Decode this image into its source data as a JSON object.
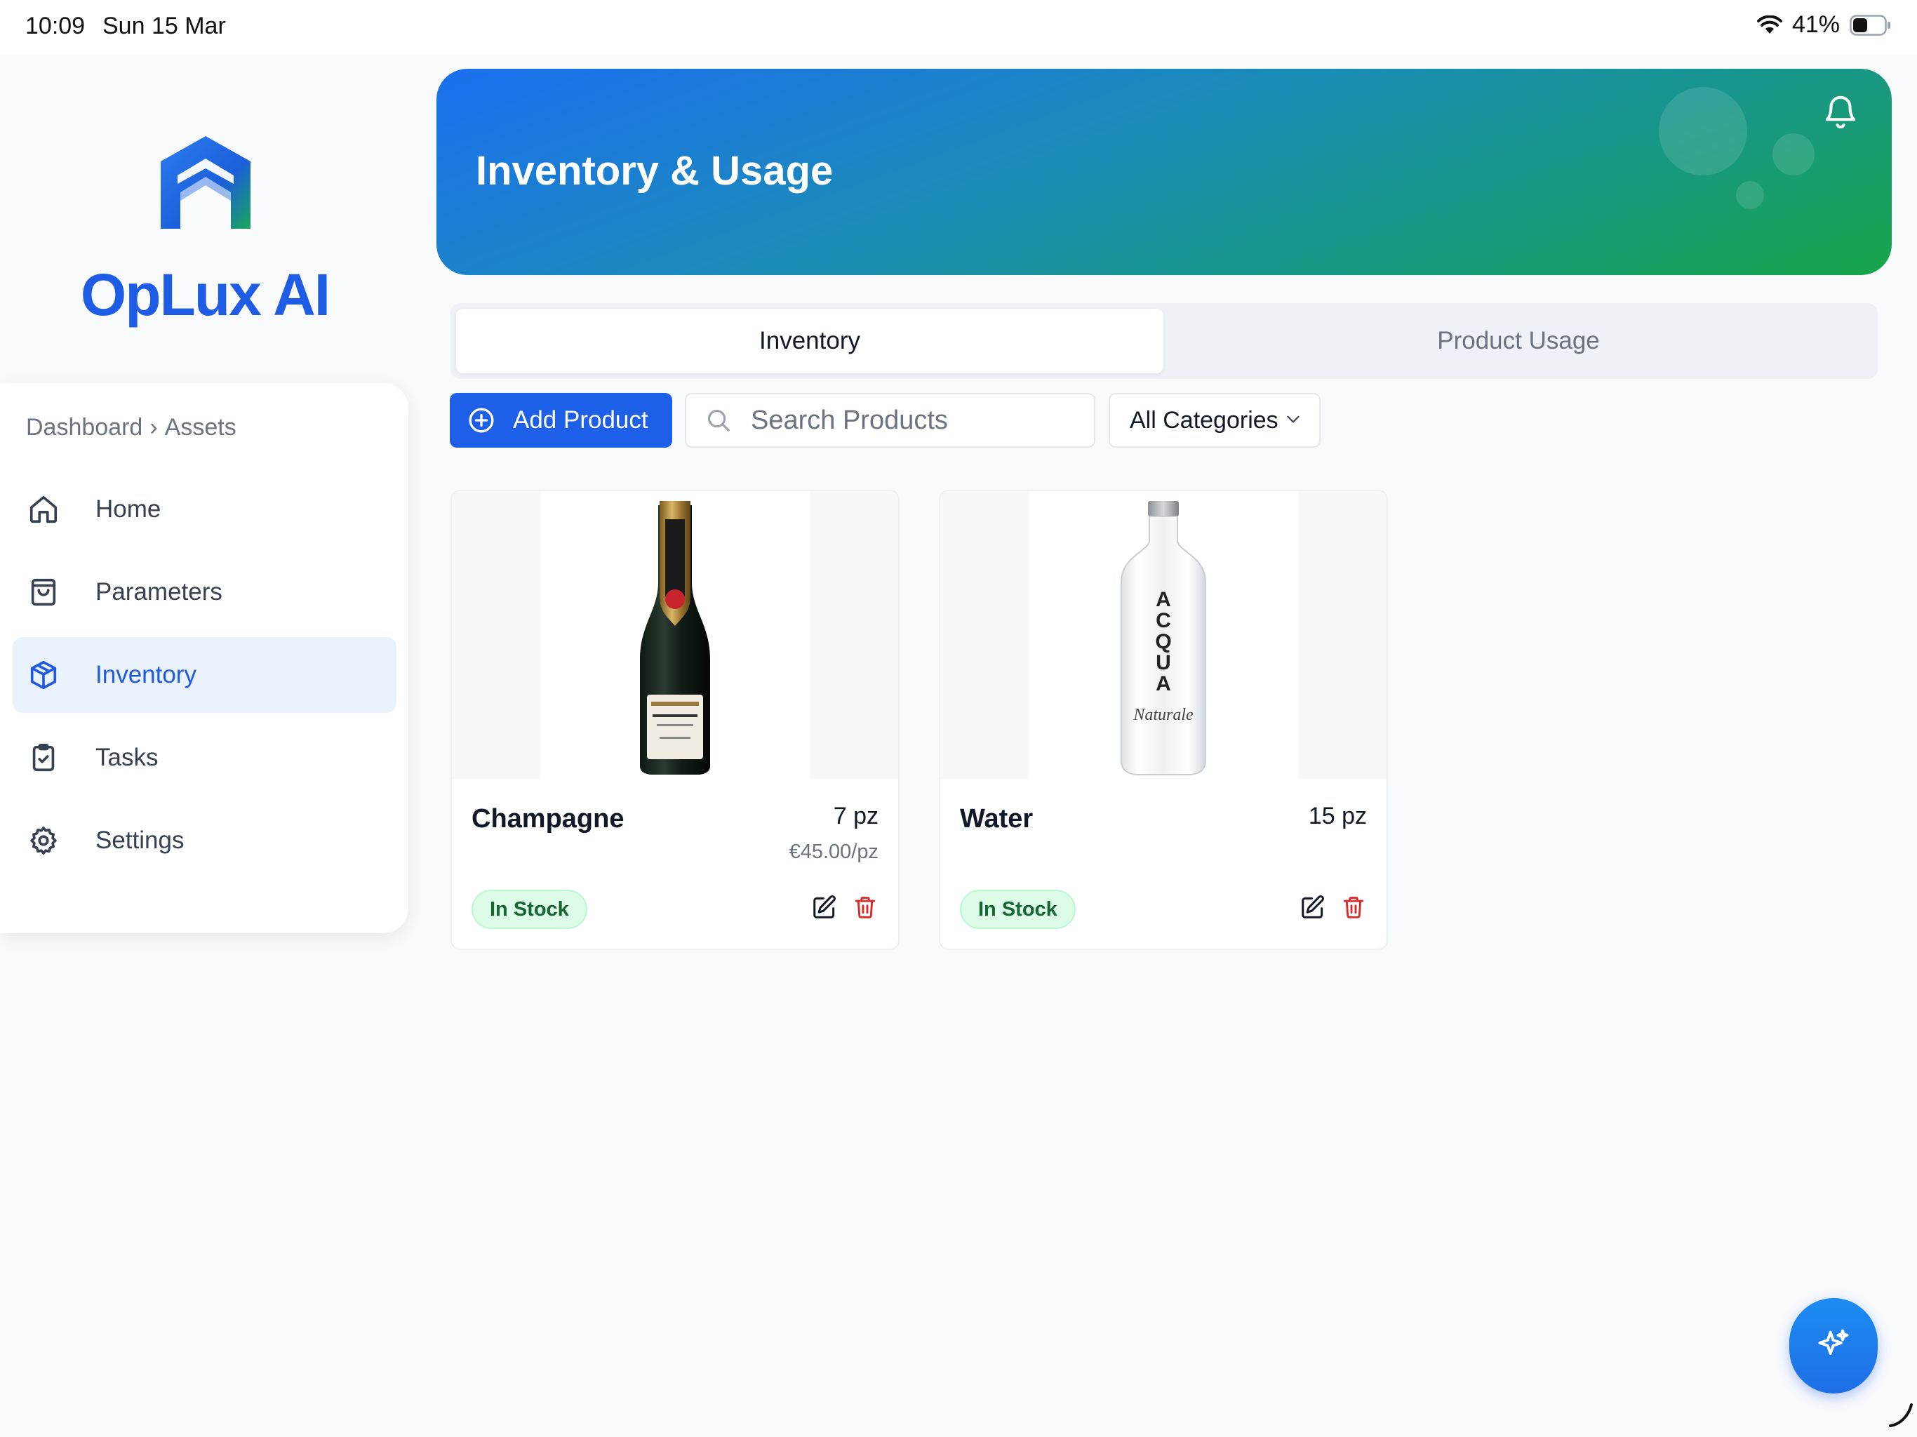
{
  "status_bar": {
    "time": "10:09",
    "date": "Sun 15 Mar",
    "battery": "41%"
  },
  "brand": {
    "name": "OpLux AI",
    "logo_icon": "oplux-logo-icon"
  },
  "sidebar": {
    "breadcrumb": {
      "root": "Dashboard",
      "separator": "›",
      "current": "Assets"
    },
    "items": [
      {
        "label": "Home",
        "icon": "home-icon",
        "active": false
      },
      {
        "label": "Parameters",
        "icon": "bag-icon",
        "active": false
      },
      {
        "label": "Inventory",
        "icon": "box-icon",
        "active": true
      },
      {
        "label": "Tasks",
        "icon": "clipboard-check-icon",
        "active": false
      },
      {
        "label": "Settings",
        "icon": "gear-icon",
        "active": false
      }
    ]
  },
  "header": {
    "title": "Inventory & Usage",
    "icon": "bell-icon"
  },
  "tabs": [
    {
      "label": "Inventory",
      "active": true
    },
    {
      "label": "Product Usage",
      "active": false
    }
  ],
  "toolbar": {
    "add_label": "Add Product",
    "search_placeholder": "Search Products",
    "search_value": "",
    "category_selected": "All Categories"
  },
  "products": [
    {
      "name": "Champagne",
      "quantity": "7 pz",
      "price": "€45.00/pz",
      "status": "In Stock",
      "image": "champagne-bottle-image"
    },
    {
      "name": "Water",
      "quantity": "15 pz",
      "price": "",
      "status": "In Stock",
      "image": "water-bottle-image"
    }
  ],
  "colors": {
    "accent": "#1d5fe6",
    "active_nav_bg": "#eaf2fe",
    "stock_badge_bg": "#dcfce7",
    "stock_badge_text": "#166534",
    "delete_icon": "#dc2626",
    "hero_gradient_start": "#1b6ff0",
    "hero_gradient_end": "#17a548"
  }
}
